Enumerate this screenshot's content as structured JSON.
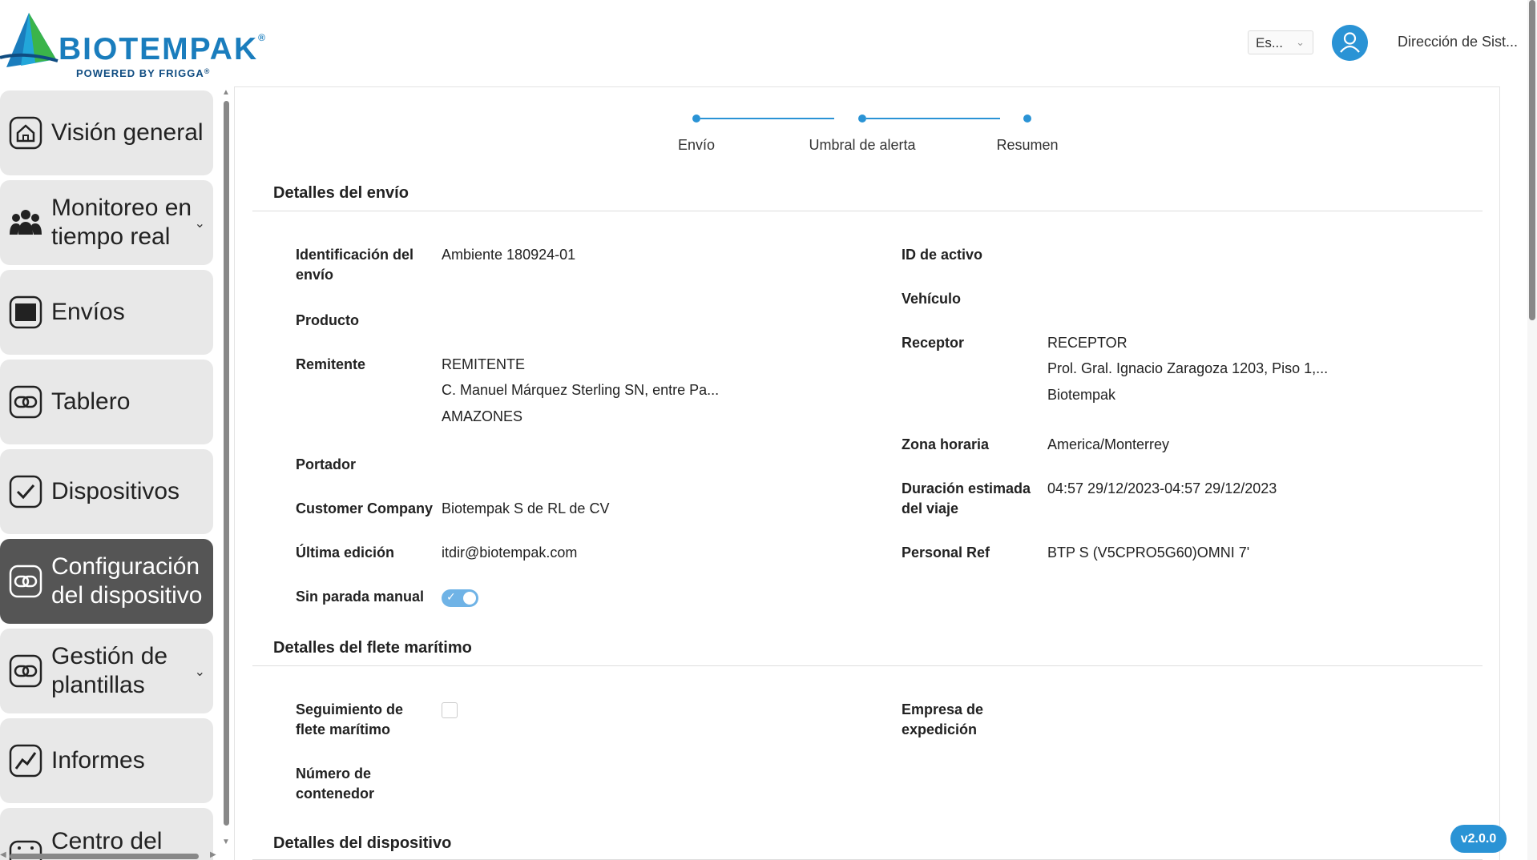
{
  "header": {
    "brand": "BIOTEMPAK",
    "brand_mark": "®",
    "brand_sub": "POWERED BY FRIGGA",
    "brand_sub_mark": "®",
    "language": "Es...",
    "user_name": "Dirección de Sist..."
  },
  "sidebar": {
    "items": [
      {
        "label": "Visión general",
        "icon": "home-icon"
      },
      {
        "label": "Monitoreo en tiempo real",
        "icon": "people-icon",
        "expandable": true
      },
      {
        "label": "Envíos",
        "icon": "box-icon"
      },
      {
        "label": "Tablero",
        "icon": "link-icon"
      },
      {
        "label": "Dispositivos",
        "icon": "check-icon"
      },
      {
        "label": "Configuración del dispositivo",
        "icon": "link-icon",
        "active": true
      },
      {
        "label": "Gestión de plantillas",
        "icon": "link-icon",
        "expandable": true
      },
      {
        "label": "Informes",
        "icon": "chart-icon"
      },
      {
        "label": "Centro del",
        "icon": "calendar-icon"
      }
    ]
  },
  "stepper": {
    "steps": [
      "Envío",
      "Umbral de alerta",
      "Resumen"
    ]
  },
  "shipment": {
    "title": "Detalles del envío",
    "left": [
      {
        "label": "Identificación del envío",
        "value": "Ambiente 180924-01"
      },
      {
        "label": "Producto",
        "value": ""
      },
      {
        "label": "Remitente",
        "lines": [
          "REMITENTE",
          "C. Manuel Márquez Sterling SN, entre Pa...",
          "AMAZONES"
        ]
      },
      {
        "label": "Portador",
        "value": ""
      },
      {
        "label": "Customer Company",
        "value": "Biotempak S de RL de CV"
      },
      {
        "label": "Última edición",
        "value": "itdir@biotempak.com"
      },
      {
        "label": "Sin parada manual",
        "toggle": true
      }
    ],
    "right": [
      {
        "label": "ID de activo",
        "value": ""
      },
      {
        "label": "Vehículo",
        "value": ""
      },
      {
        "label": "Receptor",
        "lines": [
          "RECEPTOR",
          "Prol. Gral. Ignacio Zaragoza 1203, Piso 1,...",
          "Biotempak"
        ]
      },
      {
        "label": "Zona horaria",
        "value": "America/Monterrey"
      },
      {
        "label": "Duración estimada del viaje",
        "value": "04:57 29/12/2023-04:57 29/12/2023"
      },
      {
        "label": "Personal Ref",
        "value": "BTP S (V5CPRO5G60)OMNI 7'"
      }
    ]
  },
  "maritime": {
    "title": "Detalles del flete marítimo",
    "tracking_label": "Seguimiento de flete marítimo",
    "tracking_checked": false,
    "container_label": "Número de contenedor",
    "shipping_company_label": "Empresa de expedición"
  },
  "device": {
    "title": "Detalles del dispositivo"
  },
  "version": "v2.0.0",
  "colors": {
    "accent": "#2a93d5",
    "active_nav": "#555555",
    "nav_bg": "#e8e8e8"
  }
}
